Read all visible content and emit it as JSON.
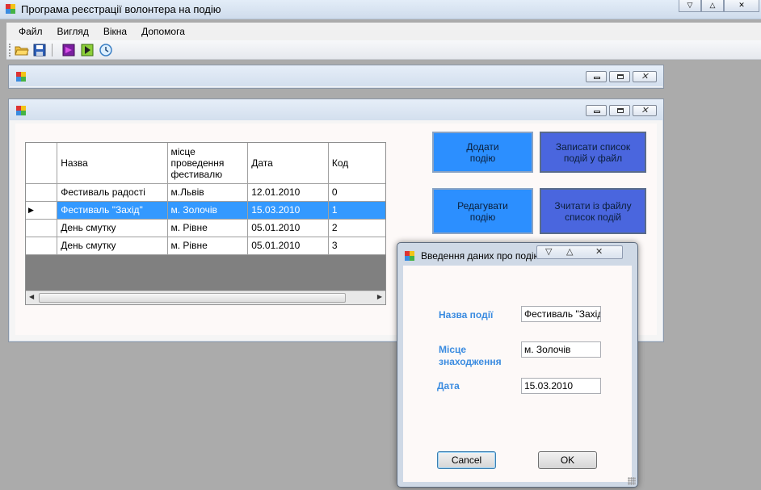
{
  "app": {
    "title": "Програма реєстрації волонтера на подію"
  },
  "menu": [
    {
      "label": "Файл"
    },
    {
      "label": "Вигляд"
    },
    {
      "label": "Вікна"
    },
    {
      "label": "Допомога"
    }
  ],
  "toolbar": {
    "icons": [
      "open-folder-icon",
      "save-icon",
      "purple-icon",
      "green-play-icon",
      "clock-icon"
    ]
  },
  "grid": {
    "columns": [
      "Назва",
      "місце проведення фестивалю",
      "Дата",
      "Код"
    ],
    "rows": [
      {
        "name": "Фестиваль радості",
        "place": "м.Львів",
        "date": "12.01.2010",
        "code": "0",
        "selected": false
      },
      {
        "name": "Фестиваль \"Захід\"",
        "place": "м. Золочів",
        "date": "15.03.2010",
        "code": "1",
        "selected": true
      },
      {
        "name": "День смутку",
        "place": "м.  Рівне",
        "date": "05.01.2010",
        "code": "2",
        "selected": false
      },
      {
        "name": "День смутку",
        "place": "м.  Рівне",
        "date": "05.01.2010",
        "code": "3",
        "selected": false
      }
    ],
    "current_row_marker": "▶"
  },
  "buttons": {
    "add_event": "Додати подію",
    "write_to_file": "Записати список подій у файл",
    "edit_event": "Редагувати подію",
    "read_from_file": "Зчитати із файлу список подій"
  },
  "dialog": {
    "title": "Введення даних про подію",
    "name_label": "Назва події",
    "name_value": "Фестиваль \"Захід\"",
    "place_label_1": "Місце",
    "place_label_2": "знаходження",
    "place_value": "м. Золочів",
    "date_label": "Дата",
    "date_value": "15.03.2010",
    "cancel_label": "Cancel",
    "ok_label": "OK"
  },
  "colors": {
    "accent_blue": "#3399ff",
    "label_blue": "#3a8be0",
    "button_light": "#2c8fff",
    "button_dark": "#4a66de"
  }
}
